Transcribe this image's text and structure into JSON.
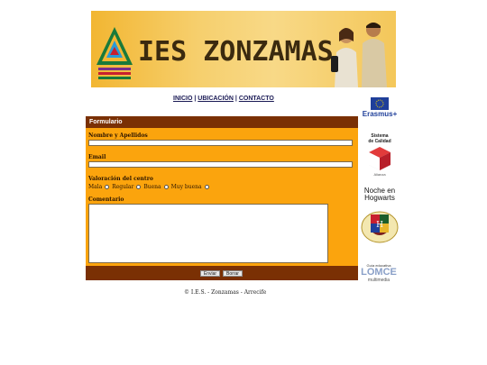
{
  "header": {
    "site_title": "IES ZONZAMAS",
    "logo_icon": "ies-triangle-logo",
    "people_image": "students-photo"
  },
  "nav": {
    "items": [
      {
        "label": "INICIO"
      },
      {
        "label": "UBICACIÓN"
      },
      {
        "label": "CONTACTO"
      }
    ],
    "separator": "|"
  },
  "form": {
    "title": "Formulario",
    "name_label": "Nombre y Apellidos",
    "name_value": "",
    "email_label": "Email",
    "email_value": "",
    "rating_label": "Valoración del centro",
    "rating_options": [
      "Mala",
      "Regular",
      "Buena",
      "Muy buena"
    ],
    "comment_label": "Comentario",
    "comment_value": "",
    "submit_label": "Enviar",
    "reset_label": "Borrar"
  },
  "footer": {
    "text": "© I.E.S. - Zonzamas - Arrecife"
  },
  "sidebar": {
    "erasmus_label": "Erasmus+",
    "calidad_line1": "Sistema",
    "calidad_line2": "de Calidad",
    "calidad_sub": "Alianza",
    "hogwarts_line1": "Noche en",
    "hogwarts_line2": "Hogwarts",
    "lomce_top": "Guía educativa",
    "lomce_mid": "LOMCE",
    "lomce_bottom": "multimedia"
  },
  "colors": {
    "form_bg": "#fba40d",
    "form_header_bg": "#7a3004",
    "nav_text": "#1a1a55",
    "banner_bg": "#f6cf6d"
  }
}
